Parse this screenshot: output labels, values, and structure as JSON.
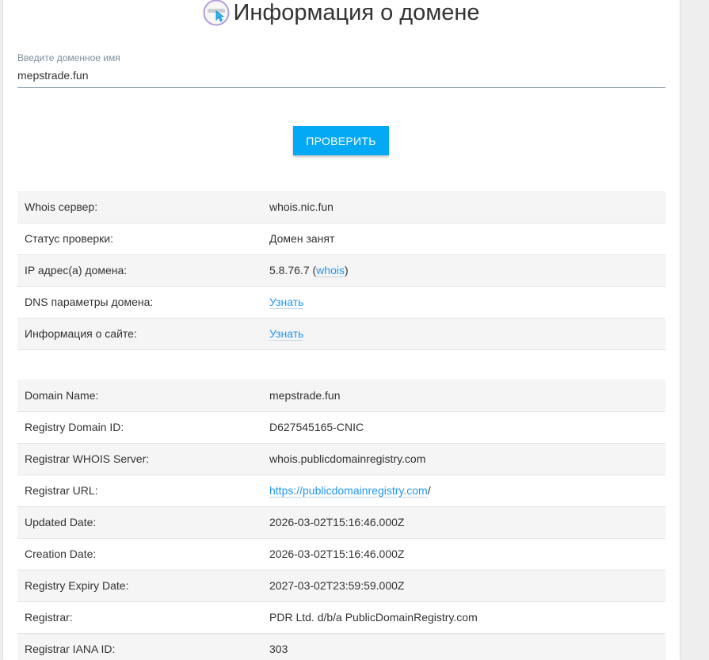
{
  "header": {
    "title": "Информация о домене",
    "icon": "domain-search-icon"
  },
  "form": {
    "label": "Введите доменное имя",
    "value": "mepstrade.fun",
    "button_label": "Проверить"
  },
  "summary": {
    "rows": [
      {
        "key": "Whois сервер:",
        "value": "whois.nic.fun"
      },
      {
        "key": "Статус проверки:",
        "value": "Домен занят"
      },
      {
        "key": "IP адрес(а) домена:",
        "ip": "5.8.76.7",
        "open_paren": " (",
        "ip_link": "whois",
        "close_paren": ")"
      },
      {
        "key": "DNS параметры домена:",
        "link": "Узнать"
      },
      {
        "key": "Информация о сайте:",
        "link": "Узнать"
      }
    ]
  },
  "whois": {
    "rows": [
      {
        "key": "Domain Name:",
        "value": "mepstrade.fun"
      },
      {
        "key": "Registry Domain ID:",
        "value": "D627545165-CNIC"
      },
      {
        "key": "Registrar WHOIS Server:",
        "value": "whois.publicdomainregistry.com"
      },
      {
        "key": "Registrar URL:",
        "link": "https://publicdomainregistry.com",
        "suffix": "/"
      },
      {
        "key": "Updated Date:",
        "value": "2026-03-02T15:16:46.000Z"
      },
      {
        "key": "Creation Date:",
        "value": "2026-03-02T15:16:46.000Z"
      },
      {
        "key": "Registry Expiry Date:",
        "value": "2027-03-02T23:59:59.000Z"
      },
      {
        "key": "Registrar:",
        "value": "PDR Ltd. d/b/a PublicDomainRegistry.com"
      },
      {
        "key": "Registrar IANA ID:",
        "value": "303"
      }
    ]
  },
  "colors": {
    "accent": "#03a9f4",
    "link": "#2196f3",
    "stripe": "#f5f5f5"
  }
}
